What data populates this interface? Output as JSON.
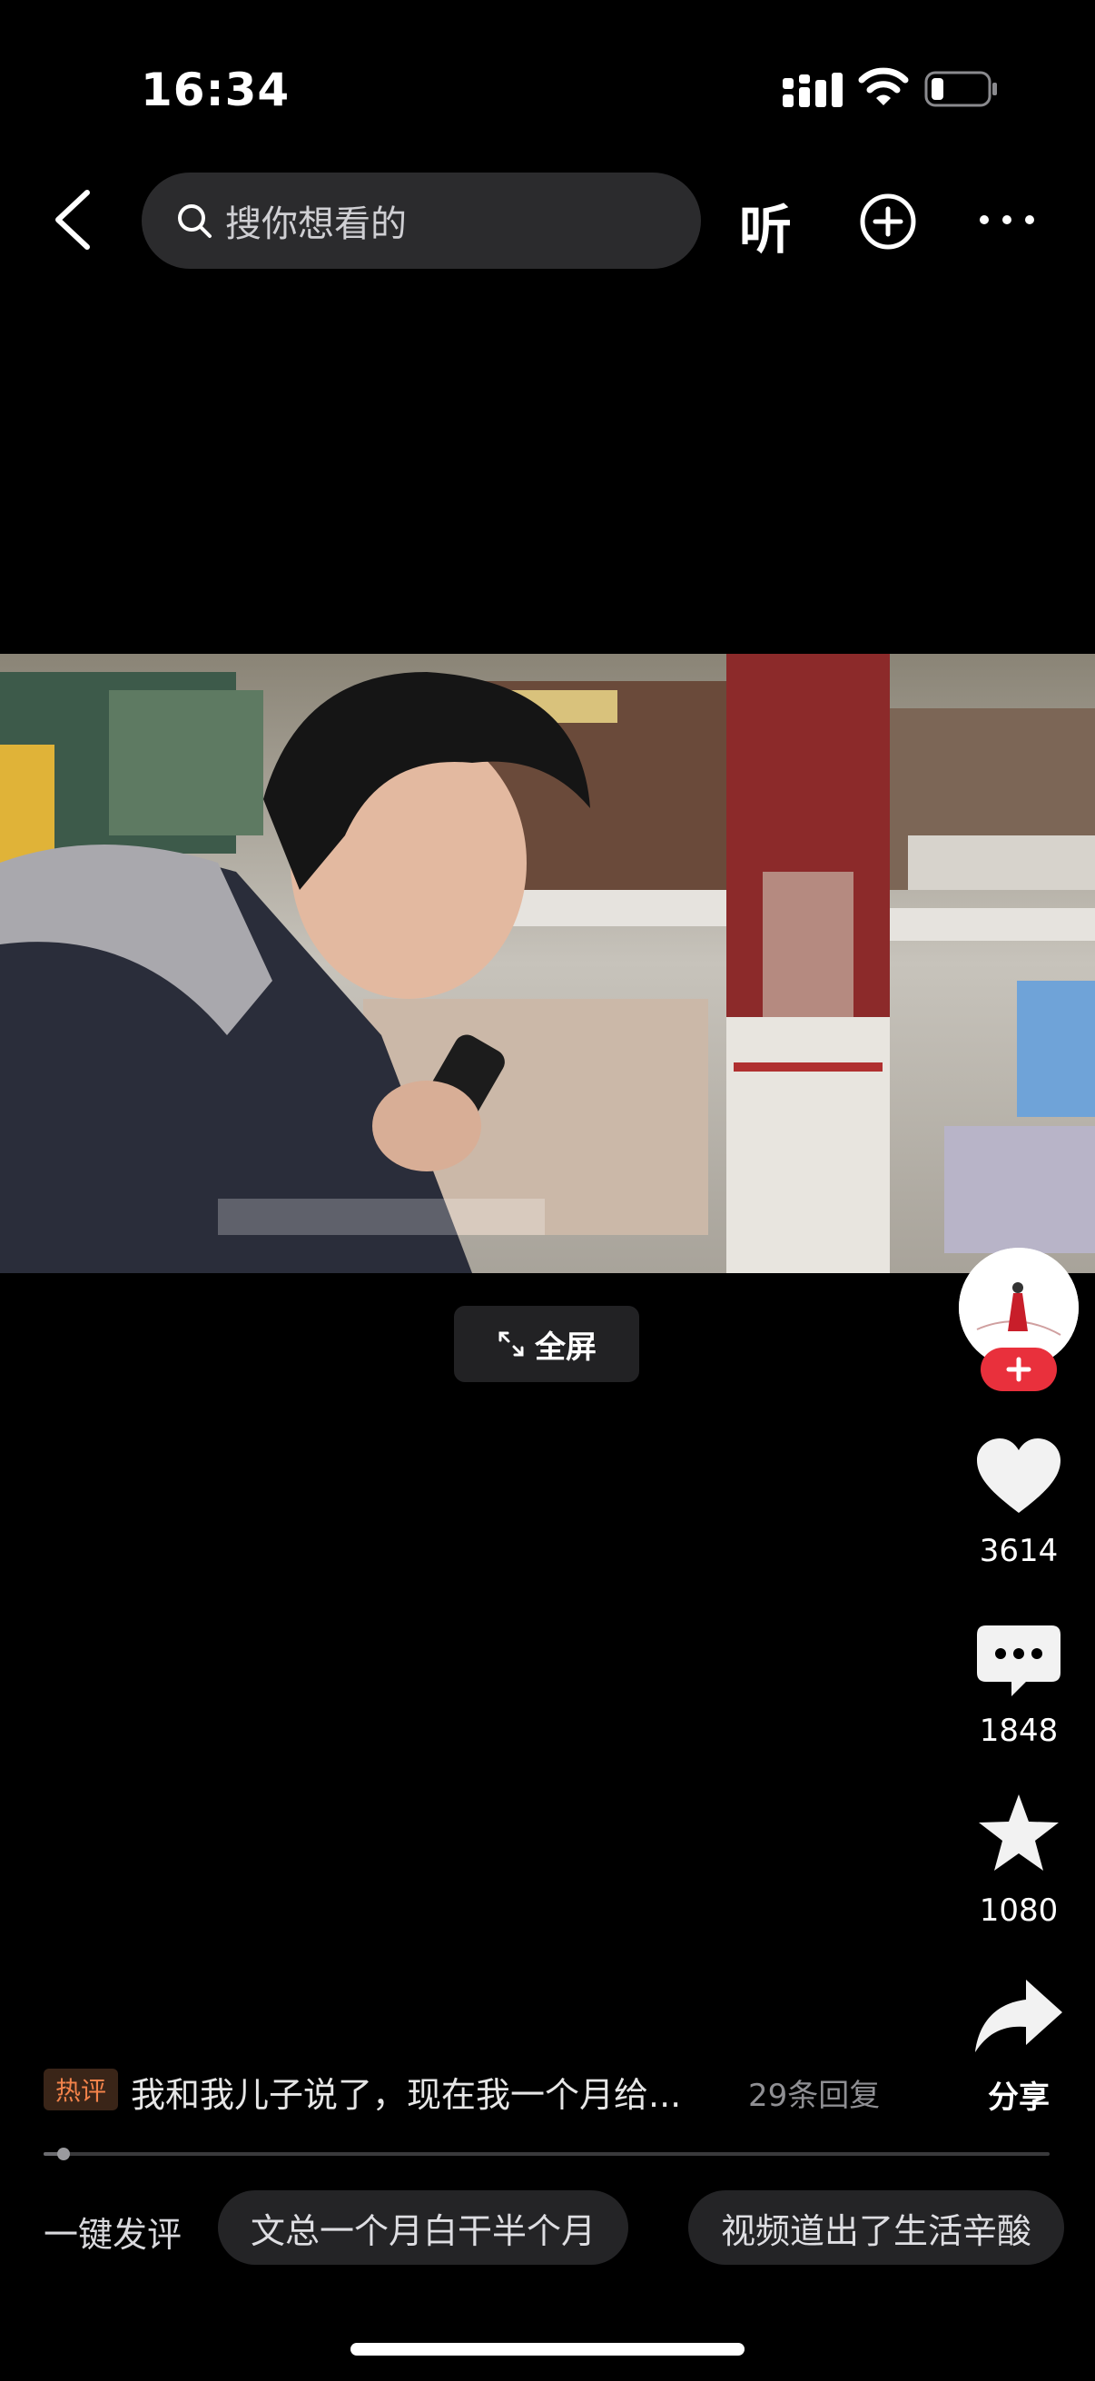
{
  "status_bar": {
    "time": "16:34",
    "battery_level": 0.15
  },
  "header": {
    "back_icon": "chevron-left-icon",
    "search_placeholder": "搜你想看的",
    "listen_label": "听",
    "add_icon": "plus-circle-icon",
    "more_icon": "ellipsis-icon"
  },
  "video": {
    "fullscreen_label": "全屏"
  },
  "actions": {
    "like_count": "3614",
    "comment_count": "1848",
    "favorite_count": "1080",
    "share_label": "分享"
  },
  "hot_comment": {
    "tag": "热评",
    "text": "我和我儿子说了，现在我一个月给...",
    "reply_count": "29条回复"
  },
  "playback": {
    "progress": 0.02
  },
  "quick_comment": {
    "label": "一键发评",
    "chips": [
      "文总一个月白干半个月",
      "视频道出了生活辛酸"
    ]
  },
  "colors": {
    "accent_red": "#e9303c",
    "hot_tag_orange": "#f2824a",
    "background": "#000000"
  }
}
